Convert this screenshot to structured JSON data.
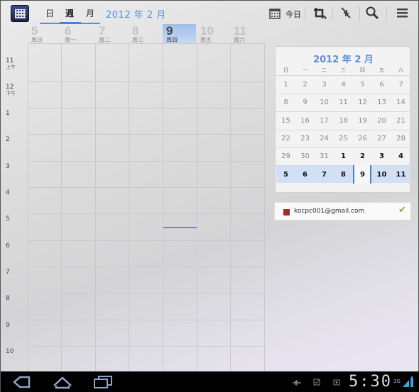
{
  "header": {
    "tabs": [
      {
        "label": "日"
      },
      {
        "label": "週"
      },
      {
        "label": "月"
      }
    ],
    "month_title": "2012 年 2 月",
    "today_label": "今日"
  },
  "week": {
    "days": [
      {
        "num": "5",
        "name": "周日"
      },
      {
        "num": "6",
        "name": "周一"
      },
      {
        "num": "7",
        "name": "周二"
      },
      {
        "num": "8",
        "name": "周三"
      },
      {
        "num": "9",
        "name": "周四"
      },
      {
        "num": "10",
        "name": "周五"
      },
      {
        "num": "11",
        "name": "周六"
      }
    ],
    "hours": [
      {
        "h": "11",
        "ampm": "上午"
      },
      {
        "h": "12",
        "ampm": "下午"
      },
      {
        "h": "1",
        "ampm": ""
      },
      {
        "h": "2",
        "ampm": ""
      },
      {
        "h": "3",
        "ampm": ""
      },
      {
        "h": "4",
        "ampm": ""
      },
      {
        "h": "5",
        "ampm": ""
      },
      {
        "h": "6",
        "ampm": ""
      },
      {
        "h": "7",
        "ampm": ""
      },
      {
        "h": "8",
        "ampm": ""
      },
      {
        "h": "9",
        "ampm": ""
      },
      {
        "h": "10",
        "ampm": ""
      }
    ]
  },
  "mini_calendar": {
    "title": "2012 年 2 月",
    "weekdays": [
      "日",
      "一",
      "二",
      "三",
      "四",
      "五",
      "六"
    ],
    "weeks": [
      [
        "1",
        "2",
        "3",
        "4",
        "5",
        "6",
        "7"
      ],
      [
        "8",
        "9",
        "10",
        "11",
        "12",
        "13",
        "14"
      ],
      [
        "15",
        "16",
        "17",
        "18",
        "19",
        "20",
        "21"
      ],
      [
        "22",
        "23",
        "24",
        "25",
        "26",
        "27",
        "28"
      ],
      [
        "29",
        "30",
        "31",
        "1",
        "2",
        "3",
        "4"
      ],
      [
        "5",
        "6",
        "7",
        "8",
        "9",
        "10",
        "11"
      ]
    ]
  },
  "account": {
    "email": "kocpc001@gmail.com",
    "color": "#a32a2a"
  },
  "system_bar": {
    "time": "5:30",
    "network": "3G"
  },
  "colors": {
    "accent": "#4f8ee0",
    "today_highlight": "#9fbde9"
  }
}
